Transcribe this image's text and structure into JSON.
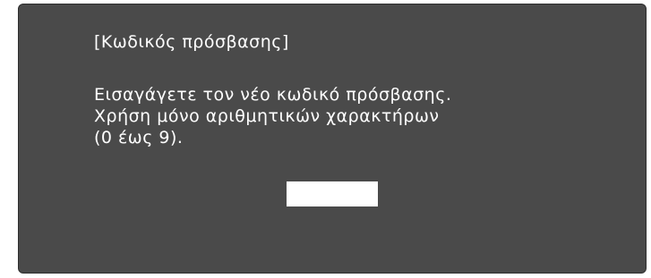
{
  "dialog": {
    "title": "[Κωδικός πρόσβασης]",
    "message_lines": [
      "Εισαγάγετε τον νέο κωδικό πρόσβασης.",
      "Χρήση μόνο αριθμητικών χαρακτήρων",
      "(0 έως 9)."
    ],
    "password_value": ""
  },
  "colors": {
    "dialog_background": "#4a4a4a",
    "text": "#ffffff",
    "input_background": "#ffffff"
  }
}
